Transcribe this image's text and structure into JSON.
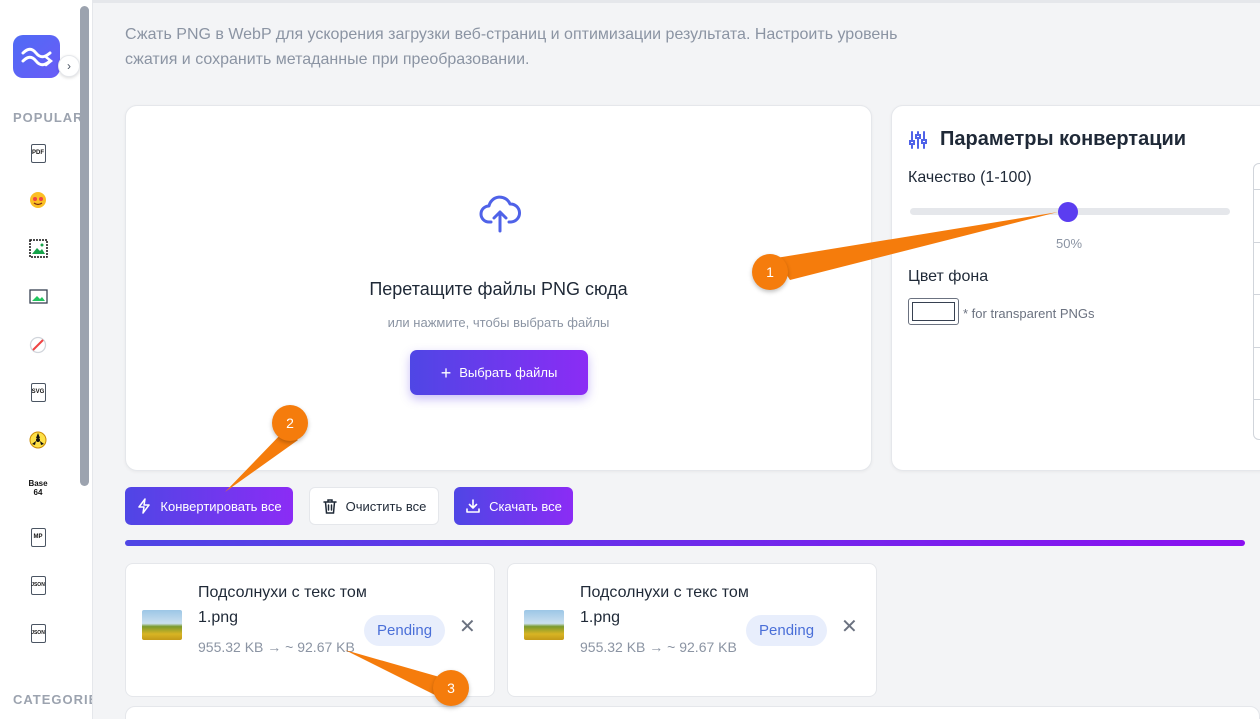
{
  "sidebar": {
    "popular_label": "POPULAR",
    "categories_label": "CATEGORIES",
    "tools": [
      {
        "icon": "pdf-file-icon",
        "text": "PDF"
      },
      {
        "icon": "emoji-icon",
        "text": ""
      },
      {
        "icon": "image-frame-icon",
        "text": ""
      },
      {
        "icon": "image-icon",
        "text": ""
      },
      {
        "icon": "no-symbol-icon",
        "text": ""
      },
      {
        "icon": "svg-file-icon",
        "text": "SVG"
      },
      {
        "icon": "radiation-icon",
        "text": ""
      },
      {
        "icon": "base64-icon",
        "text": "Base 64"
      },
      {
        "icon": "mp-file-icon",
        "text": "MP"
      },
      {
        "icon": "json-file-icon",
        "text": "JSON"
      },
      {
        "icon": "json-file-icon",
        "text": "JSON"
      }
    ]
  },
  "description": "Сжать PNG в WebP для ускорения загрузки веб-страниц и оптимизации результата. Настроить уровень сжатия и сохранить метаданные при преобразовании.",
  "dropzone": {
    "title": "Перетащите файлы PNG сюда",
    "subtitle": "или нажмите, чтобы выбрать файлы",
    "button_label": "Выбрать файлы"
  },
  "settings": {
    "title": "Параметры конвертации",
    "quality_label": "Качество (1-100)",
    "quality_value": 50,
    "quality_display": "50%",
    "background_label": "Цвет фона",
    "background_color": "#ffffff",
    "background_note": "* for transparent PNGs"
  },
  "actions": {
    "convert_all": "Конвертировать все",
    "clear_all": "Очистить все",
    "download_all": "Скачать все"
  },
  "progress": 1.0,
  "files": [
    {
      "name": "Подсолнухи с текс том 1.png",
      "size": "955.32 KB → ~ 92.67 KB",
      "status": "Pending"
    },
    {
      "name": "Подсолнухи с текс том 1.png",
      "size": "955.32 KB → ~ 92.67 KB",
      "status": "Pending"
    }
  ],
  "annotations": [
    {
      "label": "1"
    },
    {
      "label": "2"
    },
    {
      "label": "3"
    }
  ],
  "colors": {
    "accent_start": "#4f46e5",
    "accent_end": "#8b2cf5",
    "marker": "#f57c0c",
    "pending_badge_bg": "#e8eefc",
    "pending_badge_text": "#4a6fd8"
  }
}
